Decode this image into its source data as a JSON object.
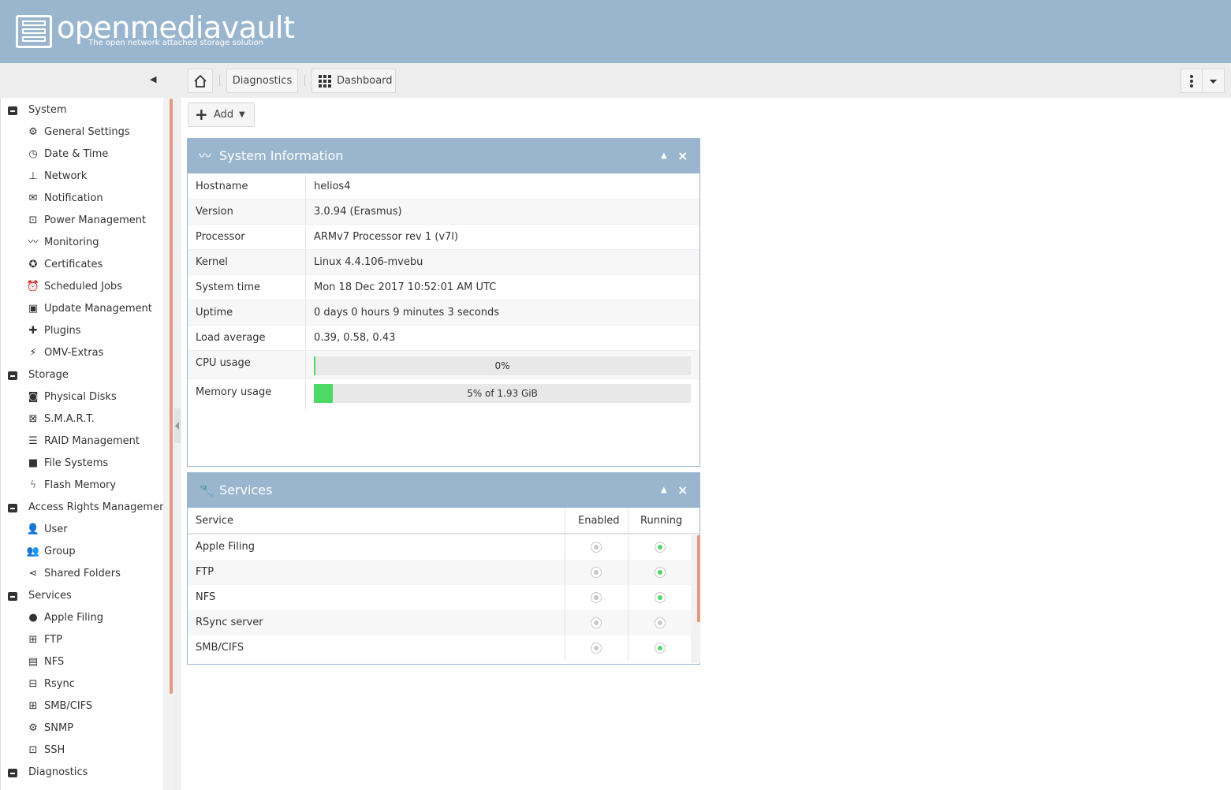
{
  "header": {
    "title": "openmediavault",
    "subtitle": "The open network attached storage solution"
  },
  "toolbar": {
    "home_icon": "home-icon",
    "breadcrumb": [
      "Diagnostics",
      "Dashboard"
    ],
    "menu_icon": "vertical-dots-icon",
    "dropdown_icon": "chevron-down-icon"
  },
  "sidebar": {
    "groups": [
      {
        "label": "System",
        "items": [
          {
            "label": "General Settings",
            "icon": "cogs-icon"
          },
          {
            "label": "Date & Time",
            "icon": "clock-icon"
          },
          {
            "label": "Network",
            "icon": "network-icon"
          },
          {
            "label": "Notification",
            "icon": "envelope-icon"
          },
          {
            "label": "Power Management",
            "icon": "power-icon"
          },
          {
            "label": "Monitoring",
            "icon": "chart-line-icon"
          },
          {
            "label": "Certificates",
            "icon": "certificate-icon"
          },
          {
            "label": "Scheduled Jobs",
            "icon": "alarm-clock-icon"
          },
          {
            "label": "Update Management",
            "icon": "package-icon"
          },
          {
            "label": "Plugins",
            "icon": "puzzle-icon"
          },
          {
            "label": "OMV-Extras",
            "icon": "plug-icon"
          }
        ]
      },
      {
        "label": "Storage",
        "items": [
          {
            "label": "Physical Disks",
            "icon": "disk-icon"
          },
          {
            "label": "S.M.A.R.T.",
            "icon": "heartbeat-icon"
          },
          {
            "label": "RAID Management",
            "icon": "database-icon"
          },
          {
            "label": "File Systems",
            "icon": "folder-icon"
          },
          {
            "label": "Flash Memory",
            "icon": "flash-icon"
          }
        ]
      },
      {
        "label": "Access Rights Management",
        "items": [
          {
            "label": "User",
            "icon": "user-icon"
          },
          {
            "label": "Group",
            "icon": "users-icon"
          },
          {
            "label": "Shared Folders",
            "icon": "share-icon"
          }
        ]
      },
      {
        "label": "Services",
        "items": [
          {
            "label": "Apple Filing",
            "icon": "apple-icon"
          },
          {
            "label": "FTP",
            "icon": "ftp-icon"
          },
          {
            "label": "NFS",
            "icon": "nfs-icon"
          },
          {
            "label": "Rsync",
            "icon": "rsync-icon"
          },
          {
            "label": "SMB/CIFS",
            "icon": "windows-icon"
          },
          {
            "label": "SNMP",
            "icon": "snmp-icon"
          },
          {
            "label": "SSH",
            "icon": "terminal-icon"
          }
        ]
      },
      {
        "label": "Diagnostics",
        "items": []
      }
    ]
  },
  "main": {
    "add_button": "Add",
    "system_info": {
      "title": "System Information",
      "rows": [
        {
          "key": "Hostname",
          "value": "helios4"
        },
        {
          "key": "Version",
          "value": "3.0.94 (Erasmus)"
        },
        {
          "key": "Processor",
          "value": "ARMv7 Processor rev 1 (v7l)"
        },
        {
          "key": "Kernel",
          "value": "Linux 4.4.106-mvebu"
        },
        {
          "key": "System time",
          "value": "Mon 18 Dec 2017 10:52:01 AM UTC"
        },
        {
          "key": "Uptime",
          "value": "0 days 0 hours 9 minutes 3 seconds"
        },
        {
          "key": "Load average",
          "value": "0.39, 0.58, 0.43"
        }
      ],
      "cpu": {
        "key": "CPU usage",
        "label": "0%",
        "percent": 0
      },
      "memory": {
        "key": "Memory usage",
        "label": "5% of 1.93 GiB",
        "percent": 5
      }
    },
    "services": {
      "title": "Services",
      "columns": [
        "Service",
        "Enabled",
        "Running"
      ],
      "rows": [
        {
          "name": "Apple Filing",
          "enabled": false,
          "running": true
        },
        {
          "name": "FTP",
          "enabled": false,
          "running": true
        },
        {
          "name": "NFS",
          "enabled": false,
          "running": true
        },
        {
          "name": "RSync server",
          "enabled": false,
          "running": false
        },
        {
          "name": "SMB/CIFS",
          "enabled": false,
          "running": true
        }
      ]
    }
  },
  "colors": {
    "header": "#9ab6cf",
    "accent": "#e39a7e",
    "ok": "#4cd964"
  }
}
